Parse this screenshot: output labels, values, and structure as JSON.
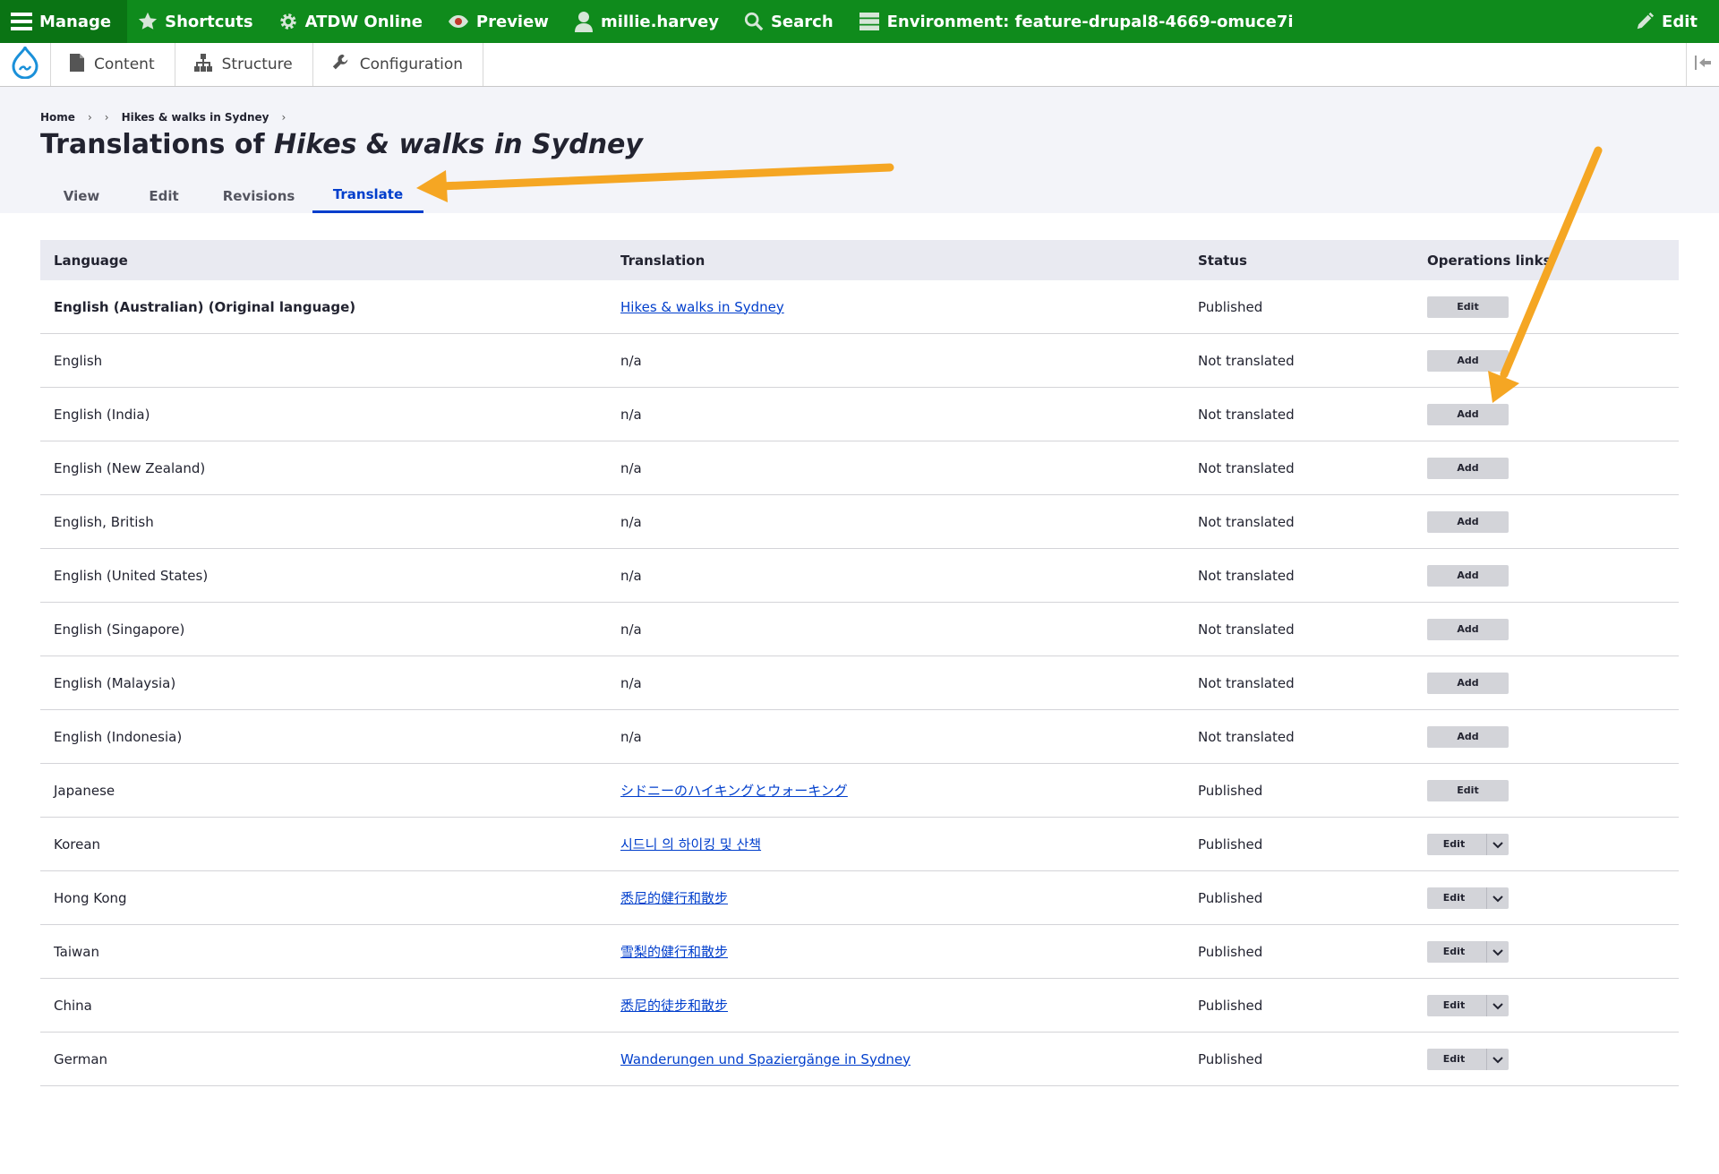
{
  "toolbar": {
    "manage": "Manage",
    "shortcuts": "Shortcuts",
    "site": "ATDW Online",
    "preview": "Preview",
    "user": "millie.harvey",
    "search": "Search",
    "environment": "Environment: feature-drupal8-4669-omuce7i",
    "edit": "Edit",
    "bg_color": "#0f8b1c"
  },
  "tray": {
    "content": "Content",
    "structure": "Structure",
    "configuration": "Configuration"
  },
  "breadcrumb": {
    "home": "Home",
    "sep": "›",
    "current": "Hikes & walks in Sydney"
  },
  "page": {
    "title_prefix": "Translations of ",
    "title_node": "Hikes & walks in Sydney"
  },
  "tabs": {
    "view": "View",
    "edit": "Edit",
    "revisions": "Revisions",
    "translate": "Translate"
  },
  "table": {
    "headers": {
      "language": "Language",
      "translation": "Translation",
      "status": "Status",
      "operations": "Operations links"
    },
    "rows": [
      {
        "language": "English (Australian) (Original language)",
        "translation": "Hikes & walks in Sydney",
        "status": "Published",
        "op": "Edit"
      },
      {
        "language": "English",
        "translation": "n/a",
        "status": "Not translated",
        "op": "Add"
      },
      {
        "language": "English (India)",
        "translation": "n/a",
        "status": "Not translated",
        "op": "Add"
      },
      {
        "language": "English (New Zealand)",
        "translation": "n/a",
        "status": "Not translated",
        "op": "Add"
      },
      {
        "language": "English, British",
        "translation": "n/a",
        "status": "Not translated",
        "op": "Add"
      },
      {
        "language": "English (United States)",
        "translation": "n/a",
        "status": "Not translated",
        "op": "Add"
      },
      {
        "language": "English (Singapore)",
        "translation": "n/a",
        "status": "Not translated",
        "op": "Add"
      },
      {
        "language": "English (Malaysia)",
        "translation": "n/a",
        "status": "Not translated",
        "op": "Add"
      },
      {
        "language": "English (Indonesia)",
        "translation": "n/a",
        "status": "Not translated",
        "op": "Add"
      },
      {
        "language": "Japanese",
        "translation": "シドニーのハイキングとウォーキング",
        "status": "Published",
        "op": "Edit"
      },
      {
        "language": "Korean",
        "translation": "시드니 의 하이킹 및 산책",
        "status": "Published",
        "op": "Edit"
      },
      {
        "language": "Hong Kong",
        "translation": "悉尼的健行和散步",
        "status": "Published",
        "op": "Edit"
      },
      {
        "language": "Taiwan",
        "translation": "雪梨的健行和散步",
        "status": "Published",
        "op": "Edit"
      },
      {
        "language": "China",
        "translation": "悉尼的徒步和散步",
        "status": "Published",
        "op": "Edit"
      },
      {
        "language": "German",
        "translation": "Wanderungen und Spaziergänge in Sydney",
        "status": "Published",
        "op": "Edit"
      }
    ]
  },
  "annotation": {
    "arrow_color": "#f5a623"
  }
}
